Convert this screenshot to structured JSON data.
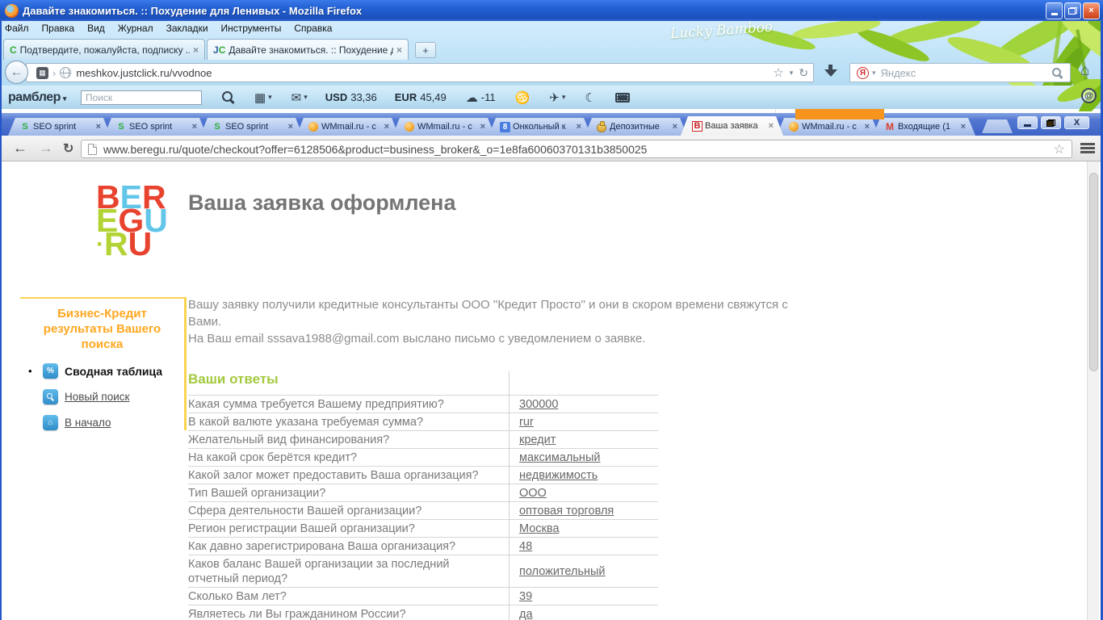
{
  "firefox": {
    "title": "Давайте знакомиться. :: Похудение для Ленивых - Mozilla Firefox",
    "theme_label": "Lucky Bamboo",
    "menu": [
      "Файл",
      "Правка",
      "Вид",
      "Журнал",
      "Закладки",
      "Инструменты",
      "Справка"
    ],
    "tabs": [
      {
        "icon_text": "C",
        "label": "Подтвердите, пожалуйста, подписку ..."
      },
      {
        "icon_j": "J",
        "icon_c": "C",
        "label": "Давайте знакомиться. :: Похудение д..."
      }
    ],
    "url": "meshkov.justclick.ru/vvodnoe",
    "search": {
      "provider_letter": "Я",
      "placeholder": "Яндекс"
    }
  },
  "rambler": {
    "brand": "рамблер",
    "search_placeholder": "Поиск",
    "usd_label": "USD",
    "usd_value": "33,36",
    "eur_label": "EUR",
    "eur_value": "45,49",
    "temperature": "-11"
  },
  "chrome": {
    "tabs": [
      {
        "label": "SEO sprint",
        "icon_text": "S"
      },
      {
        "label": "SEO sprint",
        "icon_text": "S"
      },
      {
        "label": "SEO sprint",
        "icon_text": "S"
      },
      {
        "label": "WMmail.ru - c"
      },
      {
        "label": "WMmail.ru - c"
      },
      {
        "label": "Онкольный к",
        "icon_text": "8"
      },
      {
        "label": "Депозитные"
      },
      {
        "label": "Ваша заявка",
        "icon_text": "B",
        "active": true
      },
      {
        "label": "WMmail.ru - c"
      },
      {
        "label": "Входящие (1",
        "icon_text": "M"
      }
    ],
    "url": "www.beregu.ru/quote/checkout?offer=6128506&product=business_broker&_o=1e8fa60060370131b3850025"
  },
  "page": {
    "logo": {
      "l1a": "B",
      "l1b": "E",
      "l1c": "R",
      "l2a": "E",
      "l2b": "G",
      "l2c": "U",
      "dot": "·",
      "l3a": "R",
      "l3b": "U"
    },
    "heading": "Ваша заявка оформлена",
    "intro_p1": "Вашу заявку получили кредитные консультанты ООО \"Кредит Просто\" и они в скором времени свяжутся с Вами.",
    "intro_p2": "На Ваш email sssava1988@gmail.com выслано письмо с уведомлением о заявке.",
    "sidebar": {
      "heading": "Бизнес-Кредит результаты Вашего поиска",
      "items": [
        {
          "label": "Сводная таблица",
          "icon": "percent-icon"
        },
        {
          "label": "Новый поиск",
          "icon": "search-icon"
        },
        {
          "label": "В начало",
          "icon": "home-icon"
        }
      ]
    },
    "answers": {
      "heading": "Ваши ответы",
      "rows": [
        {
          "q": "Какая сумма требуется Вашему предприятию?",
          "a": "300000"
        },
        {
          "q": "В какой валюте указана требуемая сумма?",
          "a": "rur"
        },
        {
          "q": "Желательный вид финансирования?",
          "a": "кредит"
        },
        {
          "q": "На какой срок берётся кредит?",
          "a": "максимальный"
        },
        {
          "q": "Какой залог может предоставить Ваша организация?",
          "a": "недвижимость"
        },
        {
          "q": "Тип Вашей организации?",
          "a": "ООО"
        },
        {
          "q": "Сфера деятельности Вашей организации?",
          "a": "оптовая торговля"
        },
        {
          "q": "Регион регистрации Вашей организации?",
          "a": "Москва"
        },
        {
          "q": "Как давно зарегистрирована Ваша организация?",
          "a": "48"
        },
        {
          "q": "Каков баланс Вашей организации за последний отчетный период?",
          "a": "положительный"
        },
        {
          "q": "Сколько Вам лет?",
          "a": "39"
        },
        {
          "q": "Являетесь ли Вы гражданином России?",
          "a": "да"
        }
      ]
    }
  },
  "icons": {
    "plus": "+",
    "close": "×",
    "back_arrow": "←",
    "forward_arrow": "→",
    "reload": "↻",
    "star": "☆",
    "dropdown": "▾",
    "chevron": "›",
    "grid": "▦",
    "mail": "✉",
    "cloud": "☁",
    "zodiac": "♋",
    "plane": "✈",
    "moon": "☾",
    "home": "⌂",
    "at": "@",
    "percent": "%",
    "bullet": "•",
    "minimize": "",
    "fav_grid": "▦"
  },
  "colors": {
    "xp_titlebar_blue": "#2360d2",
    "xp_close_red": "#e2613a",
    "chrome_strip_blue": "#3d63c6",
    "orange_bar": "#f7941d",
    "logo_red": "#e8432e",
    "logo_blue": "#62c6e9",
    "logo_lime": "#b3d334",
    "sidebar_heading_orange": "#ffa71f",
    "sidebar_border_yellow": "#fbd34f",
    "answers_heading_green": "#a3c93f",
    "link_gray": "#686868",
    "icon_blue": "#2f8dc9"
  }
}
